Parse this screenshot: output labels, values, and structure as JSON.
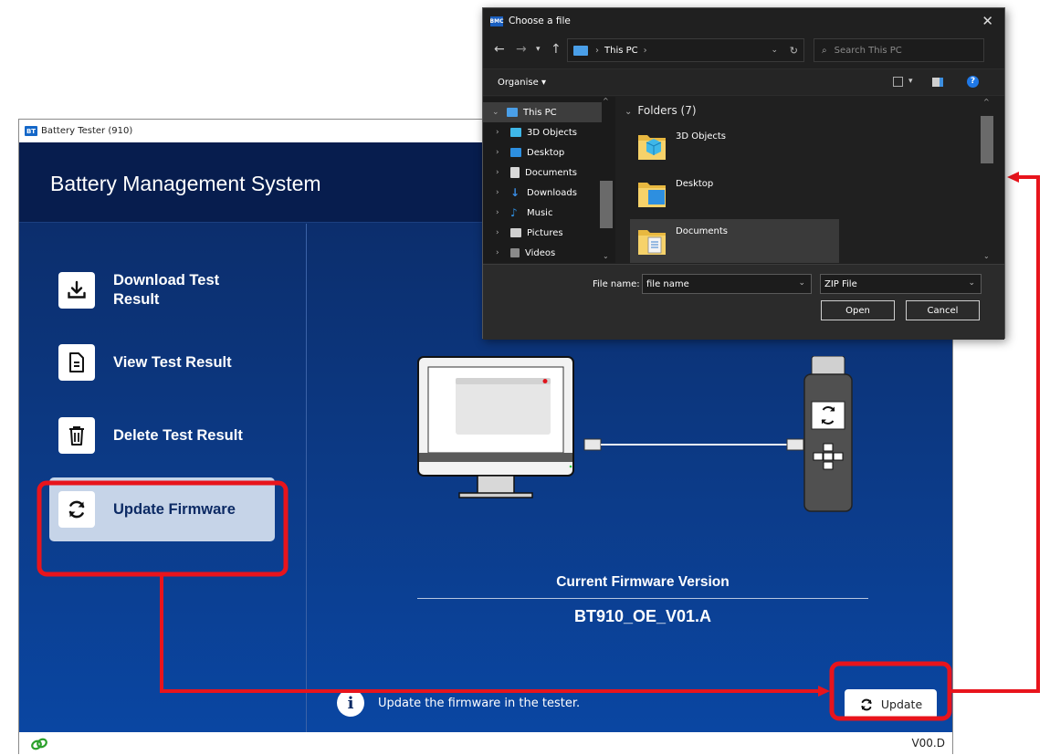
{
  "app": {
    "window_title": "Battery Tester (910)",
    "icon_text": "BT",
    "header_title": "Battery Management System",
    "nav": [
      {
        "label": "Download Test Result",
        "icon": "download-icon",
        "active": false
      },
      {
        "label": "View Test Result",
        "icon": "document-icon",
        "active": false
      },
      {
        "label": "Delete Test Result",
        "icon": "trash-icon",
        "active": false
      },
      {
        "label": "Update Firmware",
        "icon": "refresh-icon",
        "active": true
      }
    ],
    "firmware_label": "Current Firmware Version",
    "firmware_value": "BT910_OE_V01.A",
    "info_text": "Update the firmware in the tester.",
    "update_button": "Update",
    "version": "V00.D"
  },
  "dialog": {
    "title": "Choose a file",
    "icon_text": "BMC",
    "address": [
      "This PC"
    ],
    "search_placeholder": "Search This PC",
    "organise": "Organise",
    "tree": [
      {
        "label": "This PC",
        "selected": true,
        "color": "#4a9fe8"
      },
      {
        "label": "3D Objects",
        "selected": false,
        "color": "#3fb7e8"
      },
      {
        "label": "Desktop",
        "selected": false,
        "color": "#2d8fe0"
      },
      {
        "label": "Documents",
        "selected": false,
        "color": "#d8d8d8"
      },
      {
        "label": "Downloads",
        "selected": false,
        "color": "#3a8ee6"
      },
      {
        "label": "Music",
        "selected": false,
        "color": "#2f8fe0"
      },
      {
        "label": "Pictures",
        "selected": false,
        "color": "#cfcfcf"
      },
      {
        "label": "Videos",
        "selected": false,
        "color": "#8a8a8a"
      }
    ],
    "folders_heading": "Folders (7)",
    "folders": [
      {
        "name": "3D Objects",
        "selected": false
      },
      {
        "name": "Desktop",
        "selected": false
      },
      {
        "name": "Documents",
        "selected": true
      }
    ],
    "file_name_label": "File name:",
    "file_name_value": "file name",
    "file_type_value": "ZIP File",
    "open_button": "Open",
    "cancel_button": "Cancel"
  },
  "colors": {
    "annotation_red": "#e8141c",
    "app_dark": "#071d4e",
    "app_blue": "#0c3a86",
    "active_nav": "#c6d4e8"
  }
}
